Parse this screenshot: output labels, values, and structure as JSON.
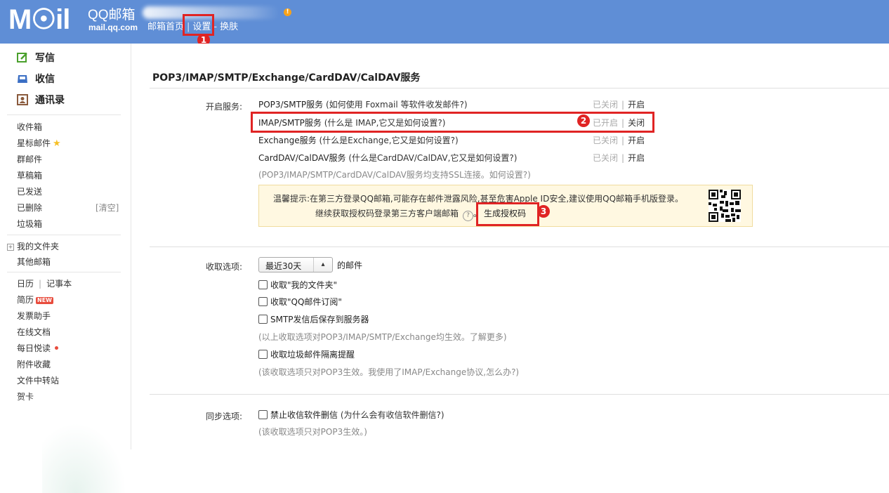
{
  "header": {
    "logo": "M☉il",
    "brand": "QQ邮箱",
    "domain": "mail.qq.com",
    "nav": [
      "邮箱首页",
      "设置",
      "换肤"
    ],
    "alert": "!"
  },
  "sidebar": {
    "main": [
      {
        "label": "写信",
        "icon": "compose-icon"
      },
      {
        "label": "收信",
        "icon": "inbox-icon"
      },
      {
        "label": "通讯录",
        "icon": "contacts-icon"
      }
    ],
    "folders": [
      "收件箱",
      "星标邮件",
      "群邮件",
      "草稿箱",
      "已发送",
      "已删除",
      "垃圾箱"
    ],
    "clear_label": "[清空]",
    "my_folders": "我的文件夹",
    "other_mailboxes": "其他邮箱",
    "apps": {
      "calendar": "日历",
      "notebook": "记事本",
      "resume": "简历",
      "new_badge": "NEW",
      "invoice": "发票助手",
      "docs": "在线文档",
      "daily": "每日悦读",
      "attachments": "附件收藏",
      "transfer": "文件中转站",
      "card": "贺卡"
    }
  },
  "services": {
    "title": "POP3/IMAP/SMTP/Exchange/CardDAV/CalDAV服务",
    "label": "开启服务:",
    "rows": [
      {
        "name": "POP3/SMTP服务",
        "help": "(如何使用 Foxmail 等软件收发邮件?)",
        "status": "已关闭",
        "action": "开启"
      },
      {
        "name": "IMAP/SMTP服务",
        "help": "(什么是 IMAP,它又是如何设置?)",
        "status": "已开启",
        "action": "关闭"
      },
      {
        "name": "Exchange服务",
        "help": "(什么是Exchange,它又是如何设置?)",
        "status": "已关闭",
        "action": "开启"
      },
      {
        "name": "CardDAV/CalDAV服务",
        "help": "(什么是CardDAV/CalDAV,它又是如何设置?)",
        "status": "已关闭",
        "action": "开启"
      }
    ],
    "ssl_note": "(POP3/IMAP/SMTP/CardDAV/CalDAV服务均支持SSL连接。如何设置?)",
    "tip_line1": "温馨提示:在第三方登录QQ邮箱,可能存在邮件泄露风险,甚至危害Apple ID安全,建议使用QQ邮箱手机版登录。",
    "tip_line2": "继续获取授权码登录第三方客户端邮箱",
    "help_glyph": "?",
    "tip_tail": "。",
    "generate": "生成授权码"
  },
  "receive": {
    "label": "收取选项:",
    "select_value": "最近30天",
    "select_suffix": "的邮件",
    "cb1": "收取\"我的文件夹\"",
    "cb2": "收取\"QQ邮件订阅\"",
    "cb3": "SMTP发信后保存到服务器",
    "note1": "(以上收取选项对POP3/IMAP/SMTP/Exchange均生效。了解更多)",
    "cb4": "收取垃圾邮件隔离提醒",
    "note2": "(该收取选项只对POP3生效。我使用了IMAP/Exchange协议,怎么办?)"
  },
  "sync": {
    "label": "同步选项:",
    "cb1": "禁止收信软件删信",
    "cb1_help": "(为什么会有收信软件删信?)",
    "note": "(该收取选项只对POP3生效。)"
  },
  "annotations": [
    "1",
    "2",
    "3"
  ],
  "colors": {
    "header": "#5f8ed6",
    "highlight": "#e02424",
    "tip_bg": "#fff8e1"
  }
}
